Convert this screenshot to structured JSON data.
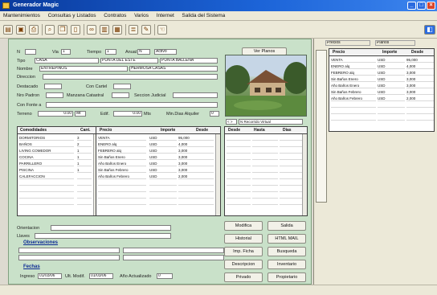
{
  "window": {
    "title": "Generador Magic",
    "colors": {
      "titlebar": "#1c64d8",
      "panel": "#c9e1c9",
      "section_title": "#0b2a94"
    }
  },
  "menu": [
    "Mantenimientos",
    "Consultas y Listados",
    "Contratos",
    "Varios",
    "Internet",
    "Salida del Sistema"
  ],
  "toolbar_icons": [
    "folder-open-icon",
    "save-icon",
    "print-icon",
    "search-icon",
    "copy-icon",
    "document-icon",
    "binoculars-icon",
    "paste-icon",
    "calendar-icon",
    "list-icon",
    "pencil-icon",
    "hand-icon"
  ],
  "header": {
    "n_label": "N",
    "via_label": "Via",
    "via_value": "1",
    "tiempo_label": "Tiempo",
    "tiempo_value": "1",
    "anual_label": "Anual",
    "anual_value": "N",
    "activo_value": "Activo",
    "ver_planos": "Ver Planos"
  },
  "form": {
    "tipo_label": "Tipo",
    "tipo_value": "CASA",
    "zona_value": "PUNTA DEL ESTE",
    "barrio_value": "PUNTA BALLENA",
    "nombre_label": "Nombre",
    "nombre_value": "ENTREPINOS",
    "nombre2_value": "HERMOSA CASAS",
    "direccion_label": "Direccion",
    "destacado_label": "Destacado",
    "con_cartel_label": "Con Cartel",
    "nro_padron_label": "Nro Padron",
    "manzana_label": "Manzana Catastral",
    "seccion_label": "Seccion Judicial",
    "con_fonte_label": "Con Fonte a",
    "terreno_label": "Terreno",
    "terreno_value": "0.00",
    "terreno_unit": "Mt",
    "edif_label": "Edif.",
    "edif_value": "0.00",
    "edif_unit": "Mts",
    "min_dias_label": "Min.Dias Alquiler",
    "min_dias_value": "0"
  },
  "photo_nav": [
    "< >",
    "N Recorrido Virtual"
  ],
  "comodidades": {
    "headers": [
      "Comodidades",
      "Cant."
    ],
    "rows": [
      [
        "DORMITORIOS",
        "3"
      ],
      [
        "BAÑOS",
        "2"
      ],
      [
        "LIVING COMEDOR",
        "1"
      ],
      [
        "COCINA",
        "1"
      ],
      [
        "PARRILLERO",
        "1"
      ],
      [
        "PISCINA",
        "1"
      ],
      [
        "CALEFACCION",
        ""
      ],
      [
        "",
        ""
      ],
      [
        "",
        ""
      ],
      [
        "",
        ""
      ],
      [
        "",
        ""
      ]
    ]
  },
  "precios": {
    "headers": [
      "Precio",
      "Importe",
      "Desde"
    ],
    "rows": [
      [
        "VENTA",
        "USD",
        "95,000"
      ],
      [
        "ENERO alq",
        "USD",
        "4,000"
      ],
      [
        "FEBRERO alq",
        "USD",
        "3,000"
      ],
      [
        "Sin Baños Enero",
        "USD",
        "3,000"
      ],
      [
        "Año Baños Enero",
        "USD",
        "3,000"
      ],
      [
        "Sin Baños Febrero",
        "USD",
        "3,000"
      ],
      [
        "Año Baños Febrero",
        "USD",
        "2,000"
      ],
      [
        "",
        "",
        ""
      ],
      [
        "",
        "",
        ""
      ],
      [
        "",
        "",
        ""
      ],
      [
        "",
        "",
        ""
      ]
    ]
  },
  "reservas": {
    "headers": [
      "Desde",
      "Hasta",
      "Dias"
    ],
    "rows": []
  },
  "bottom": {
    "orientacion_label": "Orientacion",
    "llaves_label": "Llaves",
    "observaciones_label": "Observaciones",
    "fechas_label": "Fechas",
    "ingreso_label": "Ingreso",
    "ingreso_value": "01/03/06",
    "ult_modif_label": "Ult. Modif.",
    "ult_modif_value": "01/03/06",
    "anio_act_label": "Año Actualizado",
    "anio_act_value": "0"
  },
  "buttons": [
    "Modifica",
    "Salida",
    "Historial",
    "HTML MAIL",
    "Imp. Ficha",
    "Busqueda",
    "Descripcion",
    "Inventario",
    "Privado",
    "Propietario"
  ],
  "right_window": {
    "tabs": [
      "Precios",
      "Planos"
    ],
    "headers": [
      "Precio",
      "Importe",
      "Desde"
    ],
    "rows": [
      [
        "VENTA",
        "USD",
        "95,000"
      ],
      [
        "ENERO alq",
        "USD",
        "4,000"
      ],
      [
        "FEBRERO alq",
        "USD",
        "3,000"
      ],
      [
        "Sin Baños Enero",
        "USD",
        "3,000"
      ],
      [
        "Año Baños Enero",
        "USD",
        "3,000"
      ],
      [
        "Sin Baños Febrero",
        "USD",
        "3,000"
      ],
      [
        "Año Baños Febrero",
        "USD",
        "2,000"
      ]
    ]
  }
}
